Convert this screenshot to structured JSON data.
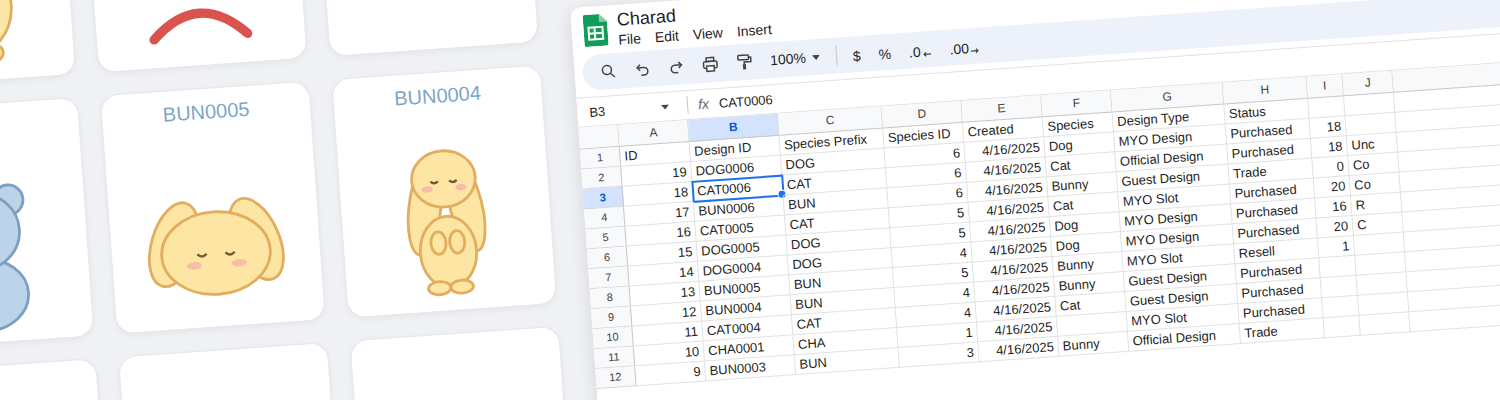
{
  "gallery": {
    "cards": [
      {
        "kind": "bunny-sit"
      },
      {
        "kind": "blob"
      },
      {
        "kind": "blank"
      },
      {
        "kind": "bear"
      },
      {
        "label": "BUN0005",
        "kind": "bunny-lie"
      },
      {
        "label": "BUN0004",
        "kind": "bunny-stand"
      },
      {
        "kind": "blank"
      },
      {
        "kind": "blank"
      },
      {
        "kind": "blank"
      }
    ]
  },
  "sheet": {
    "title": "Charad",
    "menu": [
      "File",
      "Edit",
      "View",
      "Insert"
    ],
    "toolbar": {
      "zoom": "100%",
      "formats": [
        {
          "label": "$",
          "kind": "plain"
        },
        {
          "label": "%",
          "kind": "plain"
        },
        {
          "label": ".0",
          "kind": "decrease"
        },
        {
          "label": ".00",
          "kind": "increase"
        }
      ]
    },
    "formula_bar": {
      "cell": "B3",
      "fx": "fx",
      "value": "CAT0006"
    },
    "columns": [
      {
        "letter": "A",
        "selected": false
      },
      {
        "letter": "B",
        "selected": true
      },
      {
        "letter": "C",
        "selected": false
      },
      {
        "letter": "D",
        "selected": false
      },
      {
        "letter": "E",
        "selected": false
      },
      {
        "letter": "F",
        "selected": false
      },
      {
        "letter": "G",
        "selected": false
      },
      {
        "letter": "H",
        "selected": false
      },
      {
        "letter": "I",
        "selected": false
      },
      {
        "letter": "J",
        "selected": false
      }
    ],
    "rows": [
      {
        "number": "1",
        "selected": false,
        "cells": [
          "ID",
          "Design ID",
          "Species Prefix",
          "Species ID",
          "Created",
          "Species",
          "Design Type",
          "Status",
          "",
          ""
        ]
      },
      {
        "number": "2",
        "selected": false,
        "cells": [
          "19",
          "DOG0006",
          "DOG",
          "6",
          "4/16/2025",
          "Dog",
          "MYO Design",
          "Purchased",
          "18",
          ""
        ]
      },
      {
        "number": "3",
        "selected": true,
        "cells": [
          "18",
          "CAT0006",
          "CAT",
          "6",
          "4/16/2025",
          "Cat",
          "Official Design",
          "Purchased",
          "18",
          "Unc"
        ]
      },
      {
        "number": "4",
        "selected": false,
        "cells": [
          "17",
          "BUN0006",
          "BUN",
          "6",
          "4/16/2025",
          "Bunny",
          "Guest Design",
          "Trade",
          "0",
          "Co"
        ]
      },
      {
        "number": "5",
        "selected": false,
        "cells": [
          "16",
          "CAT0005",
          "CAT",
          "5",
          "4/16/2025",
          "Cat",
          "MYO Slot",
          "Purchased",
          "20",
          "Co"
        ]
      },
      {
        "number": "6",
        "selected": false,
        "cells": [
          "15",
          "DOG0005",
          "DOG",
          "5",
          "4/16/2025",
          "Dog",
          "MYO Design",
          "Purchased",
          "16",
          "R"
        ]
      },
      {
        "number": "7",
        "selected": false,
        "cells": [
          "14",
          "DOG0004",
          "DOG",
          "4",
          "4/16/2025",
          "Dog",
          "MYO Design",
          "Purchased",
          "20",
          "C"
        ]
      },
      {
        "number": "8",
        "selected": false,
        "cells": [
          "13",
          "BUN0005",
          "BUN",
          "5",
          "4/16/2025",
          "Bunny",
          "MYO Slot",
          "Resell",
          "1",
          ""
        ]
      },
      {
        "number": "9",
        "selected": false,
        "cells": [
          "12",
          "BUN0004",
          "BUN",
          "4",
          "4/16/2025",
          "Bunny",
          "Guest Design",
          "Purchased",
          "",
          ""
        ]
      },
      {
        "number": "10",
        "selected": false,
        "cells": [
          "11",
          "CAT0004",
          "CAT",
          "4",
          "4/16/2025",
          "Cat",
          "Guest Design",
          "Purchased",
          "",
          ""
        ]
      },
      {
        "number": "11",
        "selected": false,
        "cells": [
          "10",
          "CHA0001",
          "CHA",
          "1",
          "4/16/2025",
          "",
          "MYO Slot",
          "Purchased",
          "",
          ""
        ]
      },
      {
        "number": "12",
        "selected": false,
        "cells": [
          "9",
          "BUN0003",
          "BUN",
          "3",
          "4/16/2025",
          "Bunny",
          "Official Design",
          "Trade",
          "",
          ""
        ]
      }
    ]
  }
}
